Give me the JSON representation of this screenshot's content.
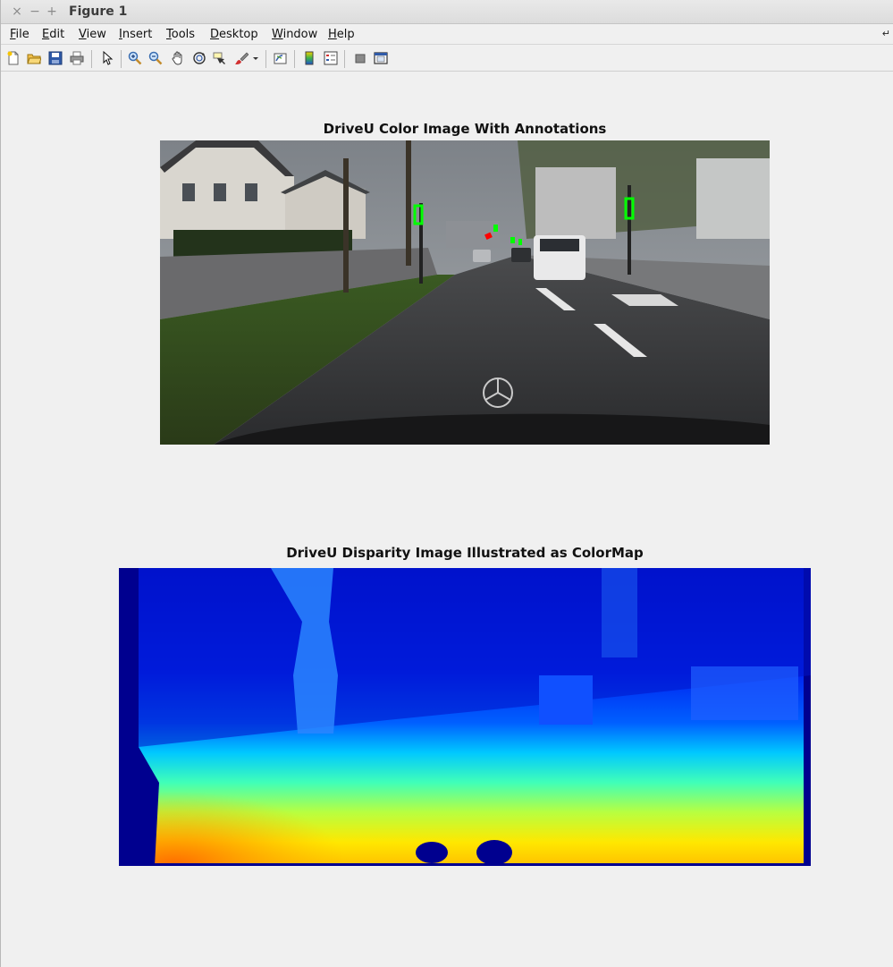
{
  "window": {
    "title": "Figure 1",
    "controls": [
      "×",
      "−",
      "+"
    ]
  },
  "menu": [
    {
      "first": "F",
      "rest": "ile"
    },
    {
      "first": "E",
      "rest": "dit"
    },
    {
      "first": "V",
      "rest": "iew"
    },
    {
      "first": "I",
      "rest": "nsert"
    },
    {
      "first": "T",
      "rest": "ools"
    },
    {
      "first": "D",
      "rest": "esktop"
    },
    {
      "first": "W",
      "rest": "indow"
    },
    {
      "first": "H",
      "rest": "elp"
    }
  ],
  "toolbar": [
    "new-figure-icon",
    "open-file-icon",
    "save-icon",
    "print-icon",
    "select-arrow-icon",
    "zoom-in-icon",
    "zoom-out-icon",
    "pan-hand-icon",
    "rotate-3d-icon",
    "data-cursor-icon",
    "brush-icon",
    "brush-dropdown-icon",
    "link-plot-icon",
    "colorbar-icon",
    "legend-icon",
    "hide-plot-tools-icon",
    "show-plot-tools-icon"
  ],
  "axes": [
    {
      "title": "DriveU Color Image With Annotations"
    },
    {
      "title": "DriveU Disparity Image Illustrated as ColorMap"
    }
  ],
  "colors": {
    "annotation_green": "#00ff00",
    "annotation_red": "#ff0000",
    "jet_dark_blue": "#00008f",
    "jet_yellow": "#ffff00"
  }
}
